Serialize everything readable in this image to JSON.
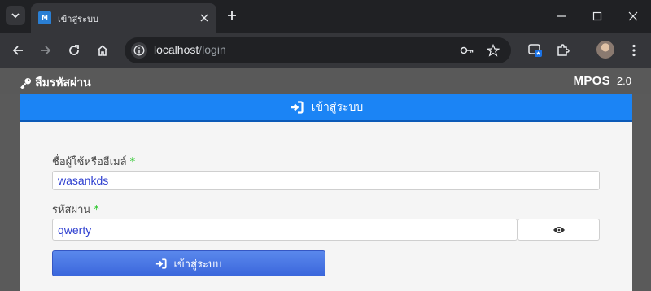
{
  "browser": {
    "tab_title": "เข้าสู่ระบบ",
    "favicon_text": "M",
    "url_host": "localhost",
    "url_path": "/login"
  },
  "header": {
    "forgot_password_label": "ลืมรหัสผ่าน",
    "brand_name": "MPOS",
    "brand_version": "2.0"
  },
  "login": {
    "title": "เข้าสู่ระบบ",
    "username_label": "ชื่อผู้ใช้หรืออีเมล์",
    "username_value": "wasankds",
    "password_label": "รหัสผ่าน",
    "password_value": "qwerty",
    "required_mark": "*",
    "submit_label": "เข้าสู่ระบบ"
  },
  "icons": {
    "forgot": "key-icon",
    "login": "sign-in-icon",
    "show_password": "eye-icon"
  },
  "colors": {
    "header_bar": "#1b84f5",
    "submit_button": "#4a78e6",
    "required": "#26c526",
    "input_text": "#2e3fd0"
  }
}
